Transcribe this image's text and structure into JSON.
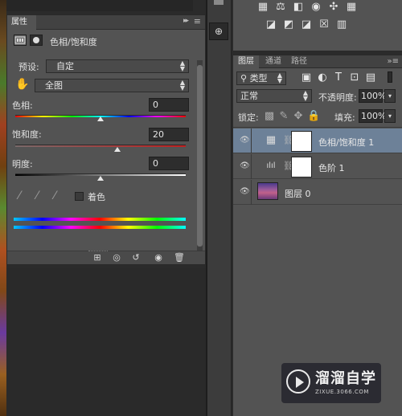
{
  "properties_panel": {
    "tab_label": "属性",
    "collapse_glyph": "▸▸",
    "menu_glyph": "≡",
    "title": "色相/饱和度",
    "preset_label": "预设:",
    "preset_value": "自定",
    "channel_value": "全图",
    "hue": {
      "label": "色相:",
      "value": "0",
      "level": 0.5
    },
    "saturation": {
      "label": "饱和度:",
      "value": "20",
      "level": 0.6
    },
    "lightness": {
      "label": "明度:",
      "value": "0",
      "level": 0.5
    },
    "colorize_label": "着色",
    "colorize_checked": false
  },
  "layers_panel": {
    "tabs": [
      "图层",
      "通道",
      "路径"
    ],
    "active_tab": 0,
    "filter_label": "类型",
    "blend_mode": "正常",
    "opacity_label": "不透明度:",
    "opacity_value": "100%",
    "lock_label": "锁定:",
    "fill_label": "填充:",
    "fill_value": "100%",
    "layers": [
      {
        "name": "色相/饱和度 1",
        "icon": "hue-saturation-icon",
        "has_mask": true,
        "selected": true
      },
      {
        "name": "色阶 1",
        "icon": "levels-icon",
        "has_mask": true,
        "selected": false
      },
      {
        "name": "图层 0",
        "icon": "photo-thumbnail",
        "has_mask": false,
        "selected": false
      }
    ]
  },
  "watermark": {
    "title": "溜溜自学",
    "url": "ZIXUE.3066.COM"
  },
  "colors": {
    "panel_bg": "#535353",
    "selected_layer": "#6d8198",
    "field_bg": "#2d2d2d"
  }
}
